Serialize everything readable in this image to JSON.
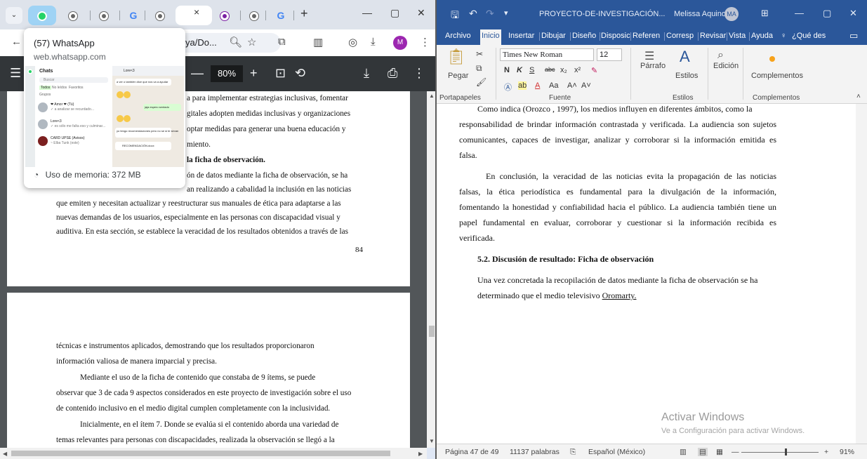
{
  "browser": {
    "close_tab_glyph": "×",
    "new_tab_glyph": "+",
    "omnibox_text": "ya/Do...",
    "profile_initial": "M",
    "pdf": {
      "zoom": "80%",
      "zoom_minus": "—",
      "zoom_plus": "+",
      "page1_lines": [
        "a para implementar estrategias inclusivas, fomentar",
        "gitales adopten medidas inclusivas y organizaciones",
        "optar medidas para generar una buena educación y",
        "miento.",
        "la ficha de observación.",
        "ón de datos mediante la ficha de observación, se ha",
        "an realizando a cabalidad la inclusión en las noticias",
        "que emiten y necesitan actualizar y reestructurar sus manuales de ética para adaptarse a las",
        "nuevas demandas de los usuarios, especialmente en las personas con discapacidad visual y",
        "auditiva. En esta sección, se establece la veracidad de los resultados obtenidos a través de las"
      ],
      "page1_number": "84",
      "page2_lines": [
        "técnicas e instrumentos aplicados, demostrando que los resultados proporcionaron",
        "información valiosa de manera imparcial y precisa.",
        "Mediante el uso de la ficha de contenido que constaba de 9 ítems, se puede",
        "observar que 3 de cada 9 aspectos considerados en este proyecto de investigación sobre el uso",
        "de contenido inclusivo en el medio digital cumplen completamente con la inclusividad.",
        "Inicialmente, en el ítem 7. Donde se evalúa si el contenido aborda una variedad de",
        "temas relevantes para personas con discapacidades, realizada la observación se llegó a la"
      ]
    },
    "hover_card": {
      "title": "(57) WhatsApp",
      "url": "web.whatsapp.com",
      "memory": "Uso de memoria: 372 MB",
      "preview": {
        "chats_header": "Chats",
        "search_placeholder": "Buscar",
        "filters": [
          "Todos",
          "No leídos",
          "Favoritos",
          "Grupos"
        ],
        "chats": [
          {
            "name": "❤ Amor ❤ (Tú)",
            "preview": "✓ a analizar se recurdado..."
          },
          {
            "name": "Lore<3",
            "preview": "✓ es sólo me falta eso y culminar..."
          },
          {
            "name": "CARD UPSE (Avisos)",
            "preview": "~ Elba Tunk (este)"
          }
        ],
        "contact": "Lore<3",
        "messages": [
          "a ver o también dice que nos va a ayudar",
          "jaja espero sentado",
          "yo tengo recomendaciones pero no se si te sirvan",
          "RECOMENDACIÓN.docx"
        ]
      }
    }
  },
  "word": {
    "title": "PROYECTO-DE-INVESTIGACIÓN...",
    "user": "Melissa Aquino",
    "user_initials": "MA",
    "tabs": [
      "Archivo",
      "Inicio",
      "Insertar",
      "Dibujar",
      "Diseño",
      "Disposic",
      "Referen",
      "Corresp",
      "Revisar",
      "Vista",
      "Ayuda",
      "¿Qué des"
    ],
    "ribbon": {
      "paste": "Pegar",
      "font_name": "Times New Roman",
      "font_size": "12",
      "bold": "N",
      "italic": "K",
      "underline": "S",
      "strike": "abc",
      "subscript": "x₂",
      "superscript": "x²",
      "font_case": "Aa",
      "grow": "A˄",
      "shrink": "A˅",
      "paragraph": "Párrafo",
      "styles": "Estilos",
      "editing": "Edición",
      "addins": "Complementos",
      "groups": [
        "Portapapeles",
        "Fuente",
        "Estilos",
        "Complementos"
      ]
    },
    "doc_lines": [
      "Como indica (Orozco , 1997), los medios influyen en diferentes ámbitos, como la",
      "responsabilidad de brindar información contrastada y verificada. La audiencia son sujetos",
      "comunicantes, capaces de investigar, analizar y corroborar si la información emitida es",
      "falsa.",
      "En conclusión, la veracidad de las noticias evita la propagación de las noticias",
      "falsas, la ética periodística es fundamental para la divulgación de la información,",
      "fomentando la honestidad y confiabilidad hacia el público. La audiencia también tiene un",
      "papel fundamental en evaluar, corroborar y cuestionar si la información recibida es",
      "verificada.",
      "5.2. Discusión de resultado: Ficha de observación",
      "Una vez concretada la recopilación de datos mediante la ficha de observación se ha",
      "determinado que el medio televisivo",
      "Oromarty."
    ],
    "watermark": {
      "title": "Activar Windows",
      "subtitle": "Ve a Configuración para activar Windows."
    },
    "status": {
      "page": "Página 47 de 49",
      "words": "11137 palabras",
      "language": "Español (México)",
      "zoom": "91%",
      "zoom_minus": "—",
      "zoom_plus": "+"
    }
  }
}
